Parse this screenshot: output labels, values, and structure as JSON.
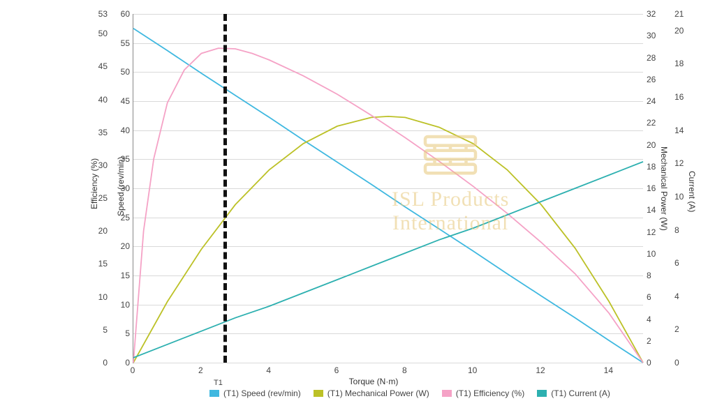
{
  "chart_data": {
    "type": "line",
    "xlabel": "Torque (N·m)",
    "x_range": [
      0,
      15
    ],
    "x_ticks": [
      0,
      2,
      4,
      6,
      8,
      10,
      12,
      14
    ],
    "axes": [
      {
        "id": "efficiency",
        "label": "Efficiency (%)",
        "side": "left-outer",
        "range": [
          0,
          53
        ],
        "ticks": [
          0,
          5,
          10,
          15,
          20,
          25,
          30,
          35,
          40,
          45,
          50,
          53
        ],
        "color": "#444"
      },
      {
        "id": "speed",
        "label": "Speed (rev/min)",
        "side": "left-inner",
        "range": [
          0,
          60
        ],
        "ticks": [
          0,
          5,
          10,
          15,
          20,
          25,
          30,
          35,
          40,
          45,
          50,
          55,
          60
        ],
        "color": "#444"
      },
      {
        "id": "mech_power",
        "label": "Mechanical Power (W)",
        "side": "right-inner",
        "range": [
          0,
          32
        ],
        "ticks": [
          0,
          2,
          4,
          6,
          8,
          10,
          12,
          14,
          16,
          18,
          20,
          22,
          24,
          26,
          28,
          30,
          32
        ],
        "color": "#444"
      },
      {
        "id": "current",
        "label": "Current (A)",
        "side": "right-outer",
        "range": [
          0,
          21
        ],
        "ticks": [
          0,
          2,
          4,
          6,
          8,
          10,
          12,
          14,
          16,
          18,
          20,
          21
        ],
        "color": "#444"
      }
    ],
    "marker_x": 2.7,
    "series": [
      {
        "name": "(T1) Speed (rev/min)",
        "axis": "speed",
        "color": "#3fb8e0",
        "x": [
          0,
          1,
          2,
          3,
          4,
          5,
          6,
          7,
          8,
          9,
          10,
          11,
          12,
          13,
          14,
          15
        ],
        "values": [
          57.5,
          53.7,
          49.8,
          46.0,
          42.2,
          38.3,
          34.5,
          30.7,
          26.8,
          23.0,
          19.2,
          15.3,
          11.5,
          7.7,
          3.8,
          0.0
        ]
      },
      {
        "name": "(T1) Mechanical Power (W)",
        "axis": "mech_power",
        "color": "#bcc127",
        "x": [
          0,
          1,
          2,
          3,
          4,
          5,
          6,
          7,
          7.5,
          8,
          9,
          10,
          11,
          12,
          13,
          14,
          15
        ],
        "values": [
          0.0,
          5.6,
          10.4,
          14.5,
          17.7,
          20.1,
          21.7,
          22.5,
          22.6,
          22.5,
          21.6,
          20.1,
          17.7,
          14.5,
          10.5,
          5.6,
          0.0
        ]
      },
      {
        "name": "(T1) Efficiency (%)",
        "axis": "efficiency",
        "color": "#f5a2c6",
        "x": [
          0,
          0.3,
          0.6,
          1.0,
          1.5,
          2.0,
          2.5,
          3.0,
          3.5,
          4.0,
          5.0,
          6.0,
          7.0,
          8.0,
          9.0,
          10.0,
          11.0,
          12.0,
          13.0,
          14.0,
          15.0
        ],
        "values": [
          0.0,
          20.0,
          31.0,
          39.5,
          44.5,
          47.0,
          47.8,
          47.7,
          47.0,
          46.0,
          43.6,
          40.8,
          37.6,
          34.2,
          30.6,
          26.8,
          22.7,
          18.3,
          13.5,
          7.5,
          0.0
        ]
      },
      {
        "name": "(T1) Current (A)",
        "axis": "current",
        "color": "#2db0b0",
        "x": [
          0,
          1,
          2,
          3,
          4,
          5,
          6,
          7,
          8,
          9,
          10,
          11,
          12,
          13,
          14,
          15
        ],
        "values": [
          0.3,
          1.1,
          1.9,
          2.7,
          3.4,
          4.2,
          5.0,
          5.8,
          6.6,
          7.4,
          8.1,
          8.9,
          9.7,
          10.5,
          11.3,
          12.1
        ]
      }
    ],
    "legend": {
      "title": "T1",
      "items": [
        "(T1) Speed (rev/min)",
        "(T1) Mechanical Power (W)",
        "(T1) Efficiency (%)",
        "(T1) Current (A)"
      ]
    },
    "watermark": {
      "line1": "ISL Products",
      "line2": "International"
    }
  }
}
